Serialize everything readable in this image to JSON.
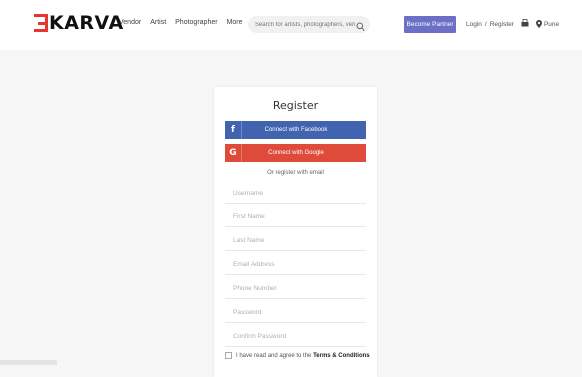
{
  "header": {
    "logo_text": "KARVA",
    "nav": [
      "Vendor",
      "Artist",
      "Photographer",
      "More"
    ],
    "search": {
      "placeholder": "Search for artists, photographers, venues"
    },
    "partner_button": "Become Partner",
    "login": "Login",
    "separator": "/",
    "register": "Register",
    "location": "Pune"
  },
  "register": {
    "title": "Register",
    "facebook": "Connect with Facebook",
    "google": "Connect with Google",
    "or_text": "Or register with email",
    "fields": [
      "Username",
      "First Name",
      "Last Name",
      "Email Address",
      "Phone Number",
      "Password",
      "Confirm Password"
    ],
    "terms_text": "I have read and agree to the",
    "terms_link": "Terms & Conditions"
  },
  "colors": {
    "brand": "#e8352d",
    "partner": "#6b6fc6",
    "facebook": "#4263b0",
    "google": "#de4b3a"
  }
}
